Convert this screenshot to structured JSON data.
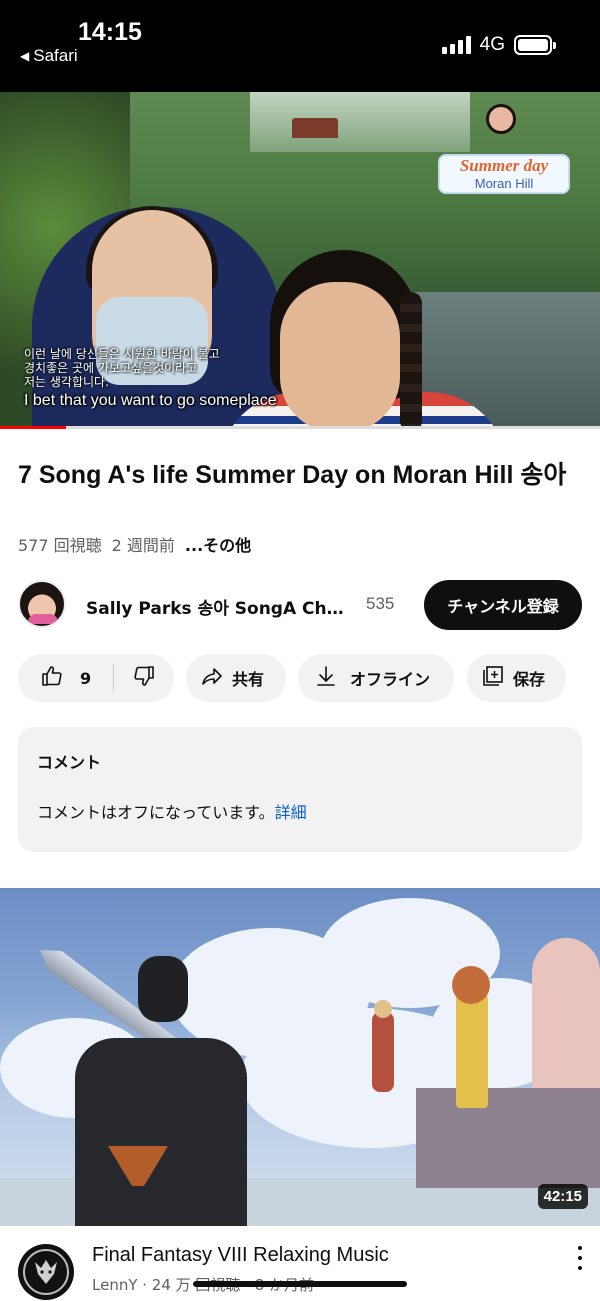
{
  "status_bar": {
    "time": "14:15",
    "back_app": "Safari",
    "network": "4G"
  },
  "player": {
    "subtitle_korean_lines": [
      "이런 날에 당신들은 시원한 바람이 불고",
      "경치좋은 곳에 가보고싶을것이라고",
      "저는 생각합니다."
    ],
    "subtitle_english": "I bet that you want to go someplace",
    "logo_main": "Summer day",
    "logo_sub": "Moran Hill",
    "progress_fraction": 0.11
  },
  "video": {
    "title": "7 Song A's life Summer Day on Moran Hill 송아",
    "views": "577 回視聴",
    "age": "2 週間前",
    "more_label": "...その他"
  },
  "channel": {
    "name": "Sally Parks 송아 SongA Chan...",
    "subscribers": "535",
    "subscribe_label": "チャンネル登録"
  },
  "actions": {
    "like_count": "9",
    "share_label": "共有",
    "download_label": "オフライン",
    "save_label": "保存"
  },
  "comments": {
    "header": "コメント",
    "message": "コメントはオフになっています。",
    "details_link": "詳細"
  },
  "next_video": {
    "duration": "42:15",
    "title": "Final Fantasy VIII Relaxing Music",
    "meta": "LennY · 24 万 回視聴 · 8 か月前"
  },
  "icons": {
    "like": "thumbs-up-icon",
    "dislike": "thumbs-down-icon",
    "share": "share-arrow-icon",
    "download": "download-icon",
    "save": "add-to-playlist-icon",
    "more": "more-vertical-icon"
  },
  "colors": {
    "subscribe_bg": "#0f0f0f",
    "link": "#065fd4",
    "progress": "#ff0000"
  }
}
